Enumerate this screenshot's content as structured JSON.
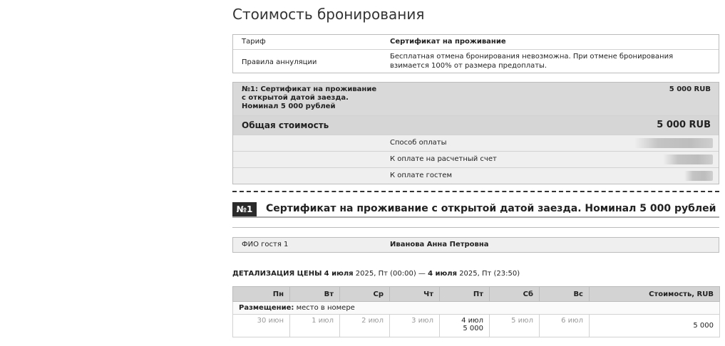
{
  "title": "Стоимость бронирования",
  "tariff": {
    "label": "Тариф",
    "value": "Сертификат на проживание"
  },
  "cancellation": {
    "label": "Правила аннуляции",
    "value": "Бесплатная отмена бронирования невозможна. При отмене бронирования взимается 100% от размера предоплаты."
  },
  "item": {
    "line1": "№1: Сертификат на проживание",
    "line2": "с открытой датой заезда.",
    "line3": "Номинал 5 000 рублей",
    "price": "5 000 RUB"
  },
  "total": {
    "label": "Общая стоимость",
    "value": "5 000 RUB"
  },
  "payment": [
    {
      "label": "Способ оплаты",
      "value_hidden_fraction": 0.3
    },
    {
      "label": "К оплате на расчетный счет",
      "value_hidden_fraction": 0.17
    },
    {
      "label": "К оплате гостем",
      "value_hidden_fraction": 0.11
    }
  ],
  "room": {
    "tag": "№1",
    "title": "Сертификат на проживание с открытой датой заезда. Номинал 5 000 рублей"
  },
  "guest": {
    "label": "ФИО гостя 1",
    "value": "Иванова Анна Петровна"
  },
  "detail": {
    "heading": "ДЕТАЛИЗАЦИЯ ЦЕНЫ",
    "from_date": "4 июля",
    "from_rest": " 2025, Пт (00:00) — ",
    "to_date": "4 июля",
    "to_rest": " 2025, Пт (23:50)"
  },
  "price_table": {
    "headers": [
      "Пн",
      "Вт",
      "Ср",
      "Чт",
      "Пт",
      "Сб",
      "Вс",
      "Стоимость, RUB"
    ],
    "placement_label": "Размещение:",
    "placement_value": "место в номере",
    "days": [
      "30 июн",
      "1 июл",
      "2 июл",
      "3 июл",
      "4 июл",
      "5 июл",
      "6 июл"
    ],
    "active_day_price": "5 000",
    "total": "5 000"
  }
}
